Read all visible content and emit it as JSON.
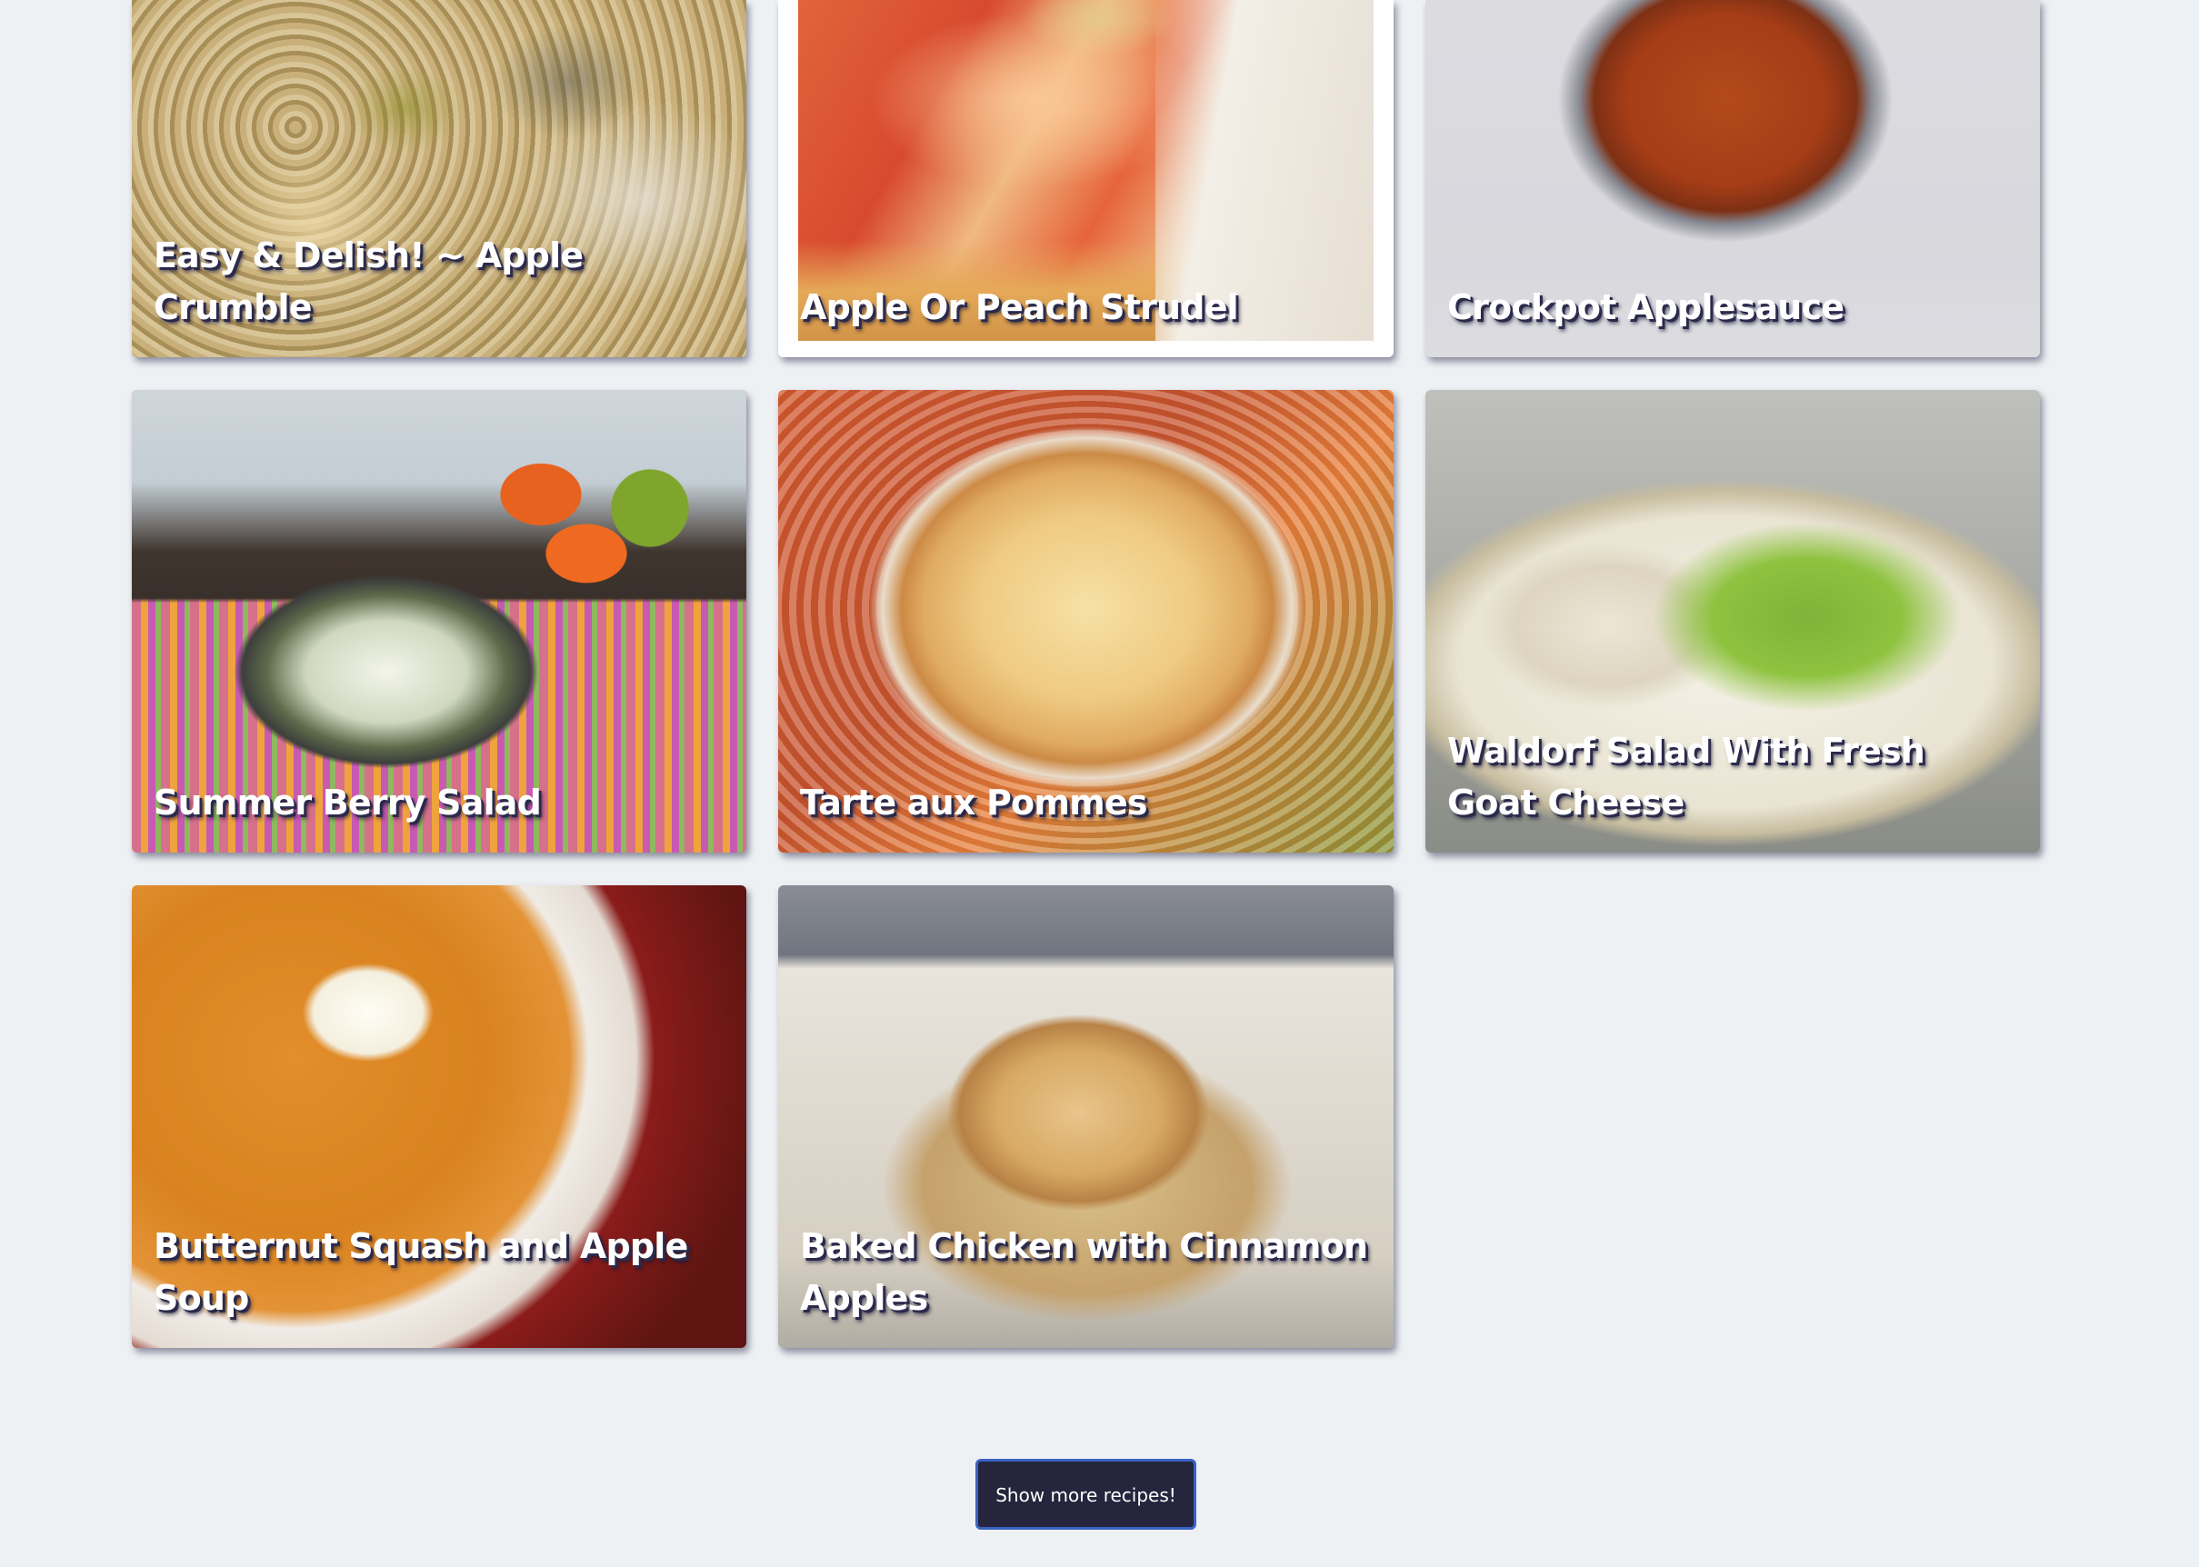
{
  "recipes": [
    {
      "title": "Easy & Delish! ~ Apple Crumble"
    },
    {
      "title": "Apple Or Peach Strudel"
    },
    {
      "title": "Crockpot Applesauce"
    },
    {
      "title": "Summer Berry Salad"
    },
    {
      "title": "Tarte aux Pommes"
    },
    {
      "title": "Waldorf Salad With Fresh Goat Cheese"
    },
    {
      "title": "Butternut Squash and Apple Soup"
    },
    {
      "title": "Baked Chicken with Cinnamon Apples"
    }
  ],
  "show_more": {
    "label": "Show more recipes!"
  },
  "colors": {
    "page_background": "#eef1f4",
    "button_background": "#25253d",
    "button_border": "#3a63c4",
    "title_shadow": "#2b2a4c"
  }
}
